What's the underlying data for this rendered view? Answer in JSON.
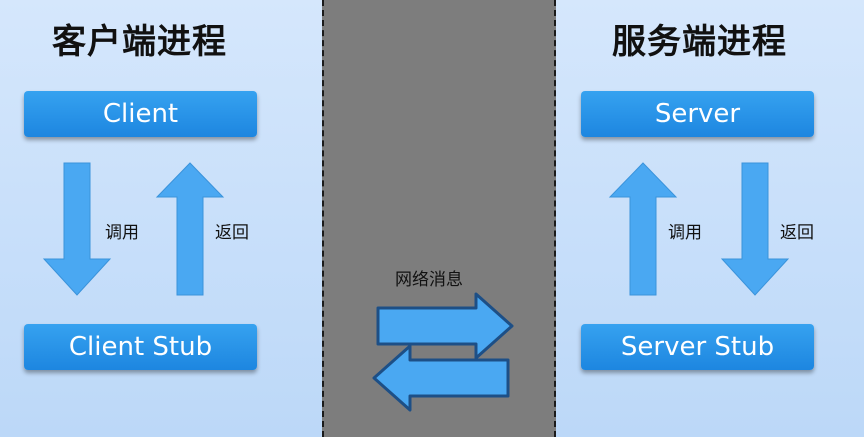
{
  "left": {
    "title": "客户端进程",
    "top_box": "Client",
    "bottom_box": "Client Stub",
    "down_label": "调用",
    "up_label": "返回"
  },
  "right": {
    "title": "服务端进程",
    "top_box": "Server",
    "bottom_box": "Server Stub",
    "up_label": "调用",
    "down_label": "返回"
  },
  "middle": {
    "label": "网络消息"
  },
  "colors": {
    "box_blue": "#1d86e0",
    "arrow_blue": "#4aa8f2",
    "panel_bg": "#cfe3fb",
    "middle_bg": "#7d7d7d"
  }
}
